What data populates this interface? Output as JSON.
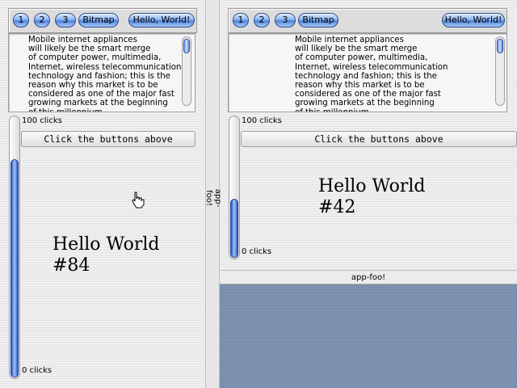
{
  "left": {
    "toolbar": {
      "buttons": [
        "1",
        "2",
        "3",
        "Bitmap"
      ],
      "hello_button": "Hello, World!"
    },
    "text": "Mobile internet appliances\nwill likely be the smart merge\nof computer power, multimedia,\nInternet, wireless telecommunication\ntechnology and fashion; this is the\nreason why this market is to be\nconsidered as one of the major fast\ngrowing markets at the beginning\nof this millennium.",
    "slider": {
      "max_label": "100 clicks",
      "min_label": "0 clicks",
      "value_fraction": 0.84
    },
    "header_button": "Click the buttons above",
    "hello_text": "Hello World\n#84"
  },
  "right": {
    "toolbar": {
      "buttons": [
        "1",
        "2",
        "3",
        "Bitmap"
      ],
      "hello_button": "Hello, World!"
    },
    "text": "Mobile internet appliances\nwill likely be the smart merge\nof computer power, multimedia,\nInternet, wireless telecommunication\ntechnology and fashion; this is the\nreason why this market is to be\nconsidered as one of the major fast\ngrowing markets at the beginning\nof this millennium.",
    "slider": {
      "max_label": "100 clicks",
      "min_label": "0 clicks",
      "value_fraction": 0.42
    },
    "header_button": "Click the buttons above",
    "hello_text": "Hello World\n#42"
  },
  "splitter_label": "app-foo!",
  "bottom_bar_label": "app-foo!",
  "colors": {
    "accent": "#4f82d8",
    "bottom_area": "#7a8fad"
  }
}
